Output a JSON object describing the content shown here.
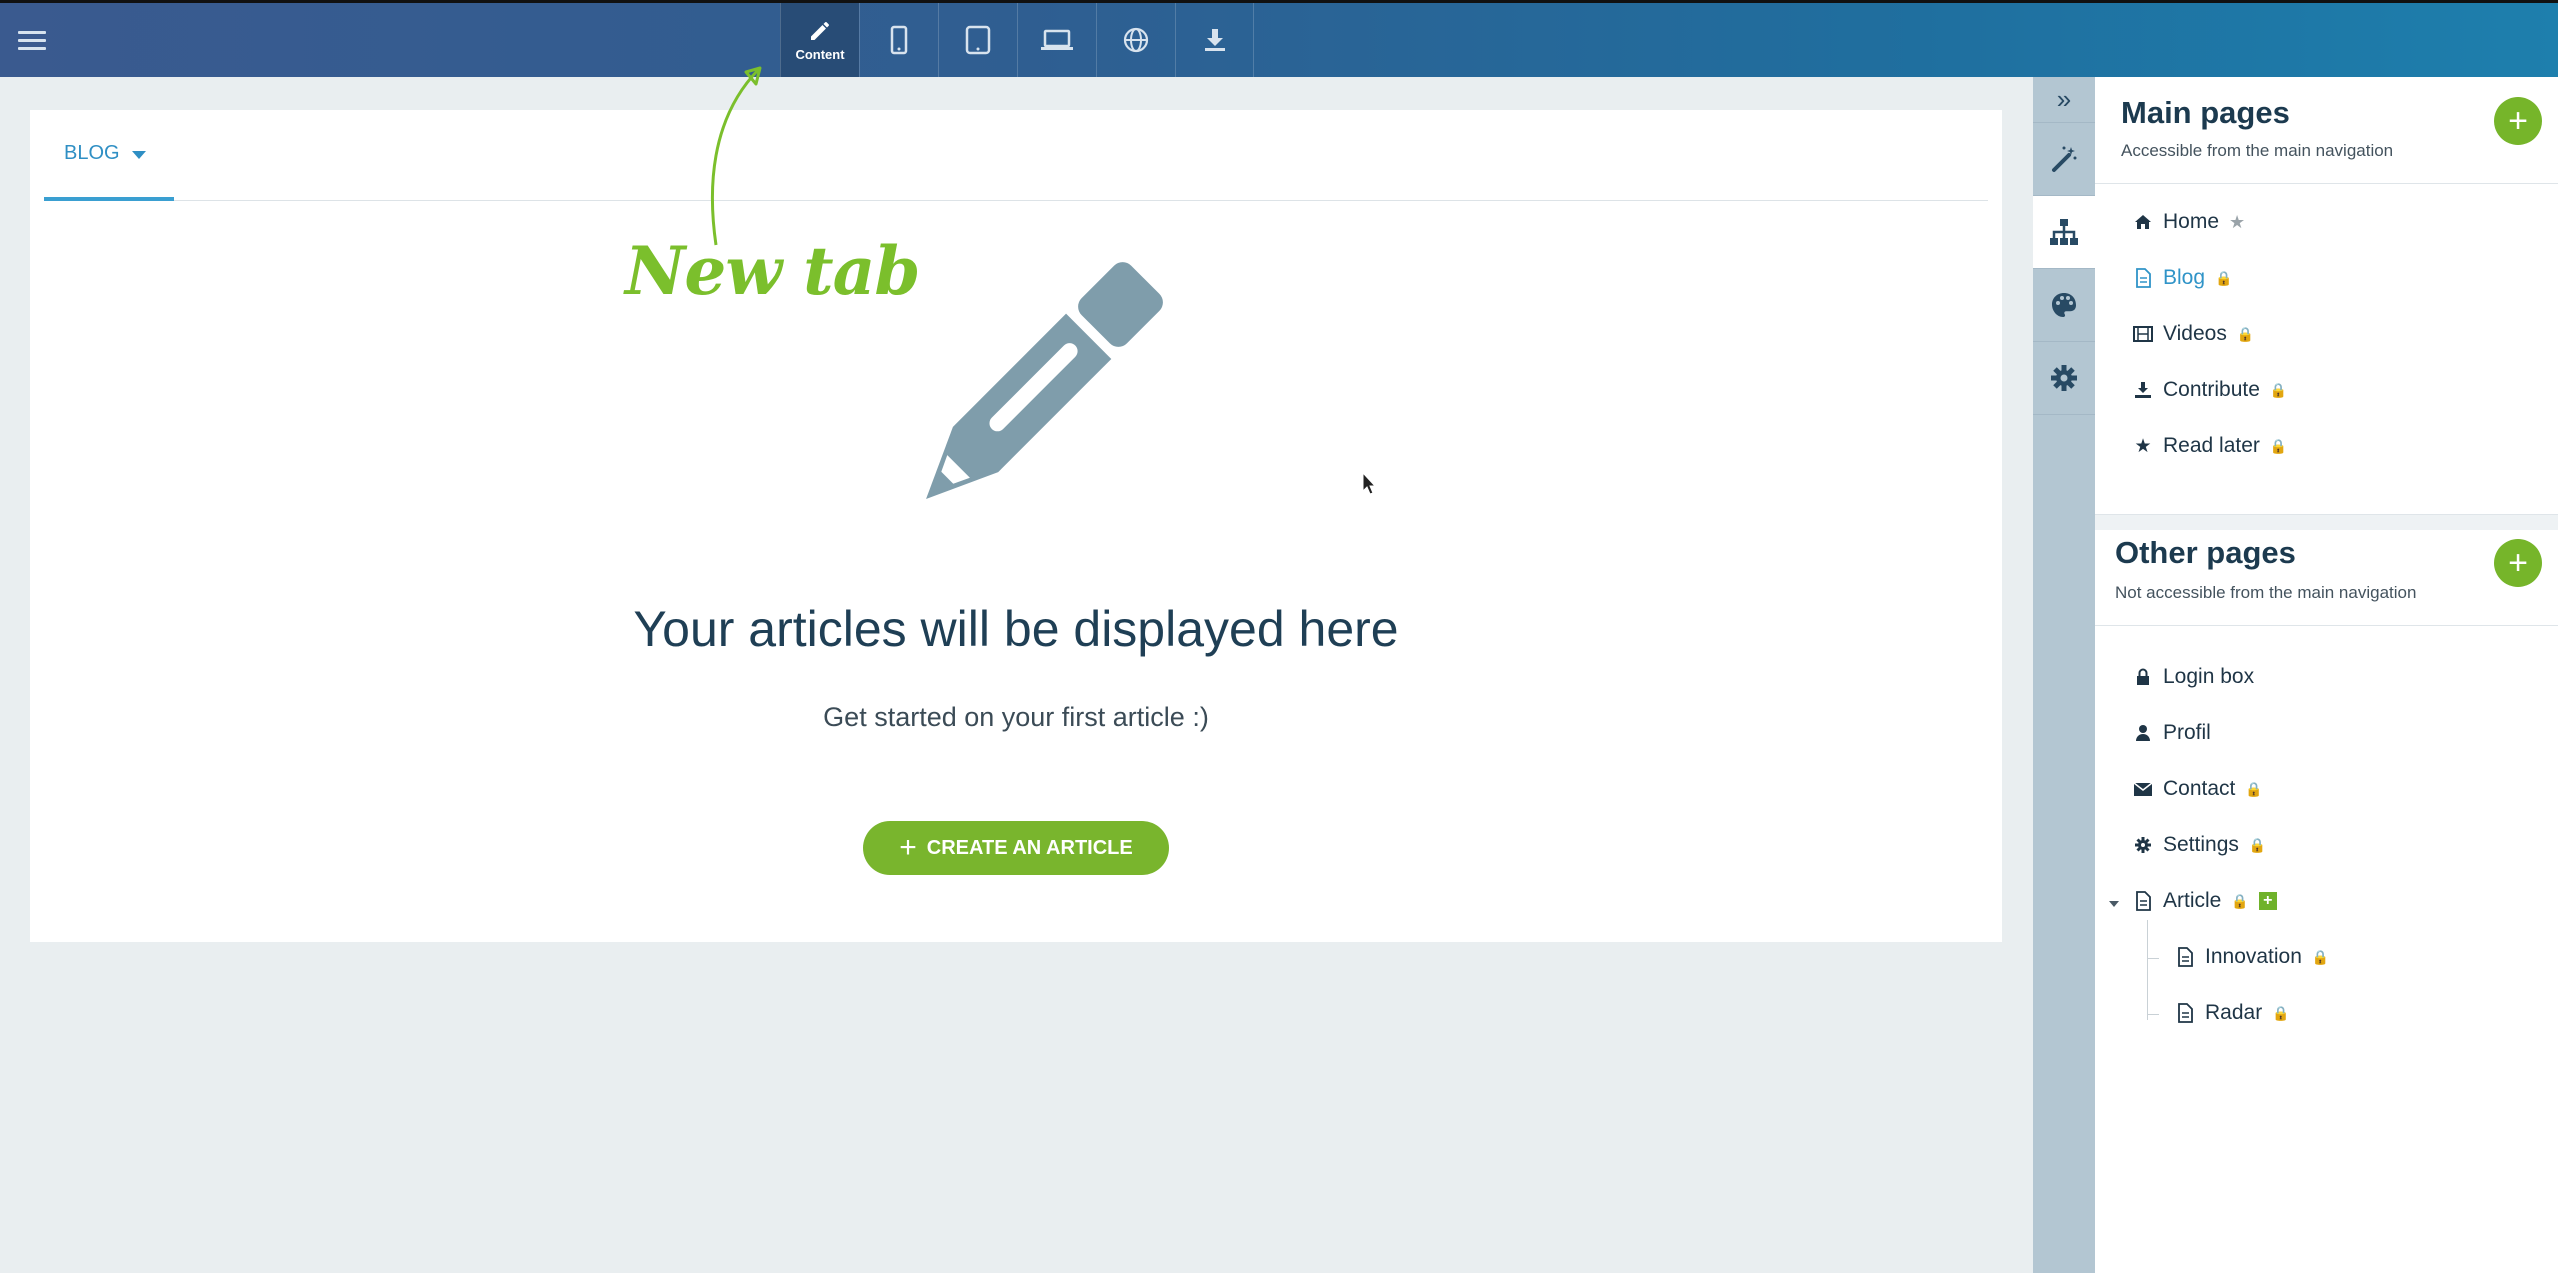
{
  "toolbar": {
    "content_label": "Content",
    "tools": [
      "content",
      "mobile",
      "tablet",
      "laptop",
      "web",
      "download"
    ]
  },
  "page": {
    "tab_label": "BLOG",
    "hero_title": "Your articles will be displayed here",
    "hero_subtitle": "Get started on your first article :)",
    "create_button": "CREATE AN ARTICLE"
  },
  "annotation": {
    "text": "New tab"
  },
  "main_pages": {
    "title": "Main pages",
    "subtitle": "Accessible from the main navigation",
    "items": [
      {
        "label": "Home",
        "icon": "home-icon"
      },
      {
        "label": "Blog",
        "icon": "document-icon",
        "selected": true
      },
      {
        "label": "Videos",
        "icon": "film-icon"
      },
      {
        "label": "Contribute",
        "icon": "download-icon"
      },
      {
        "label": "Read later",
        "icon": "star-icon"
      }
    ]
  },
  "other_pages": {
    "title": "Other pages",
    "subtitle": "Not accessible from the main navigation",
    "items": [
      {
        "label": "Login box",
        "icon": "lock-icon"
      },
      {
        "label": "Profil",
        "icon": "user-icon"
      },
      {
        "label": "Contact",
        "icon": "envelope-icon"
      },
      {
        "label": "Settings",
        "icon": "gear-icon"
      },
      {
        "label": "Article",
        "icon": "document-icon"
      },
      {
        "label": "Innovation",
        "icon": "document-icon"
      },
      {
        "label": "Radar",
        "icon": "document-icon"
      }
    ]
  },
  "colors": {
    "accent_green": "#76b52a",
    "accent_blue": "#3094c8",
    "header_dark": "#1c3a4f"
  }
}
